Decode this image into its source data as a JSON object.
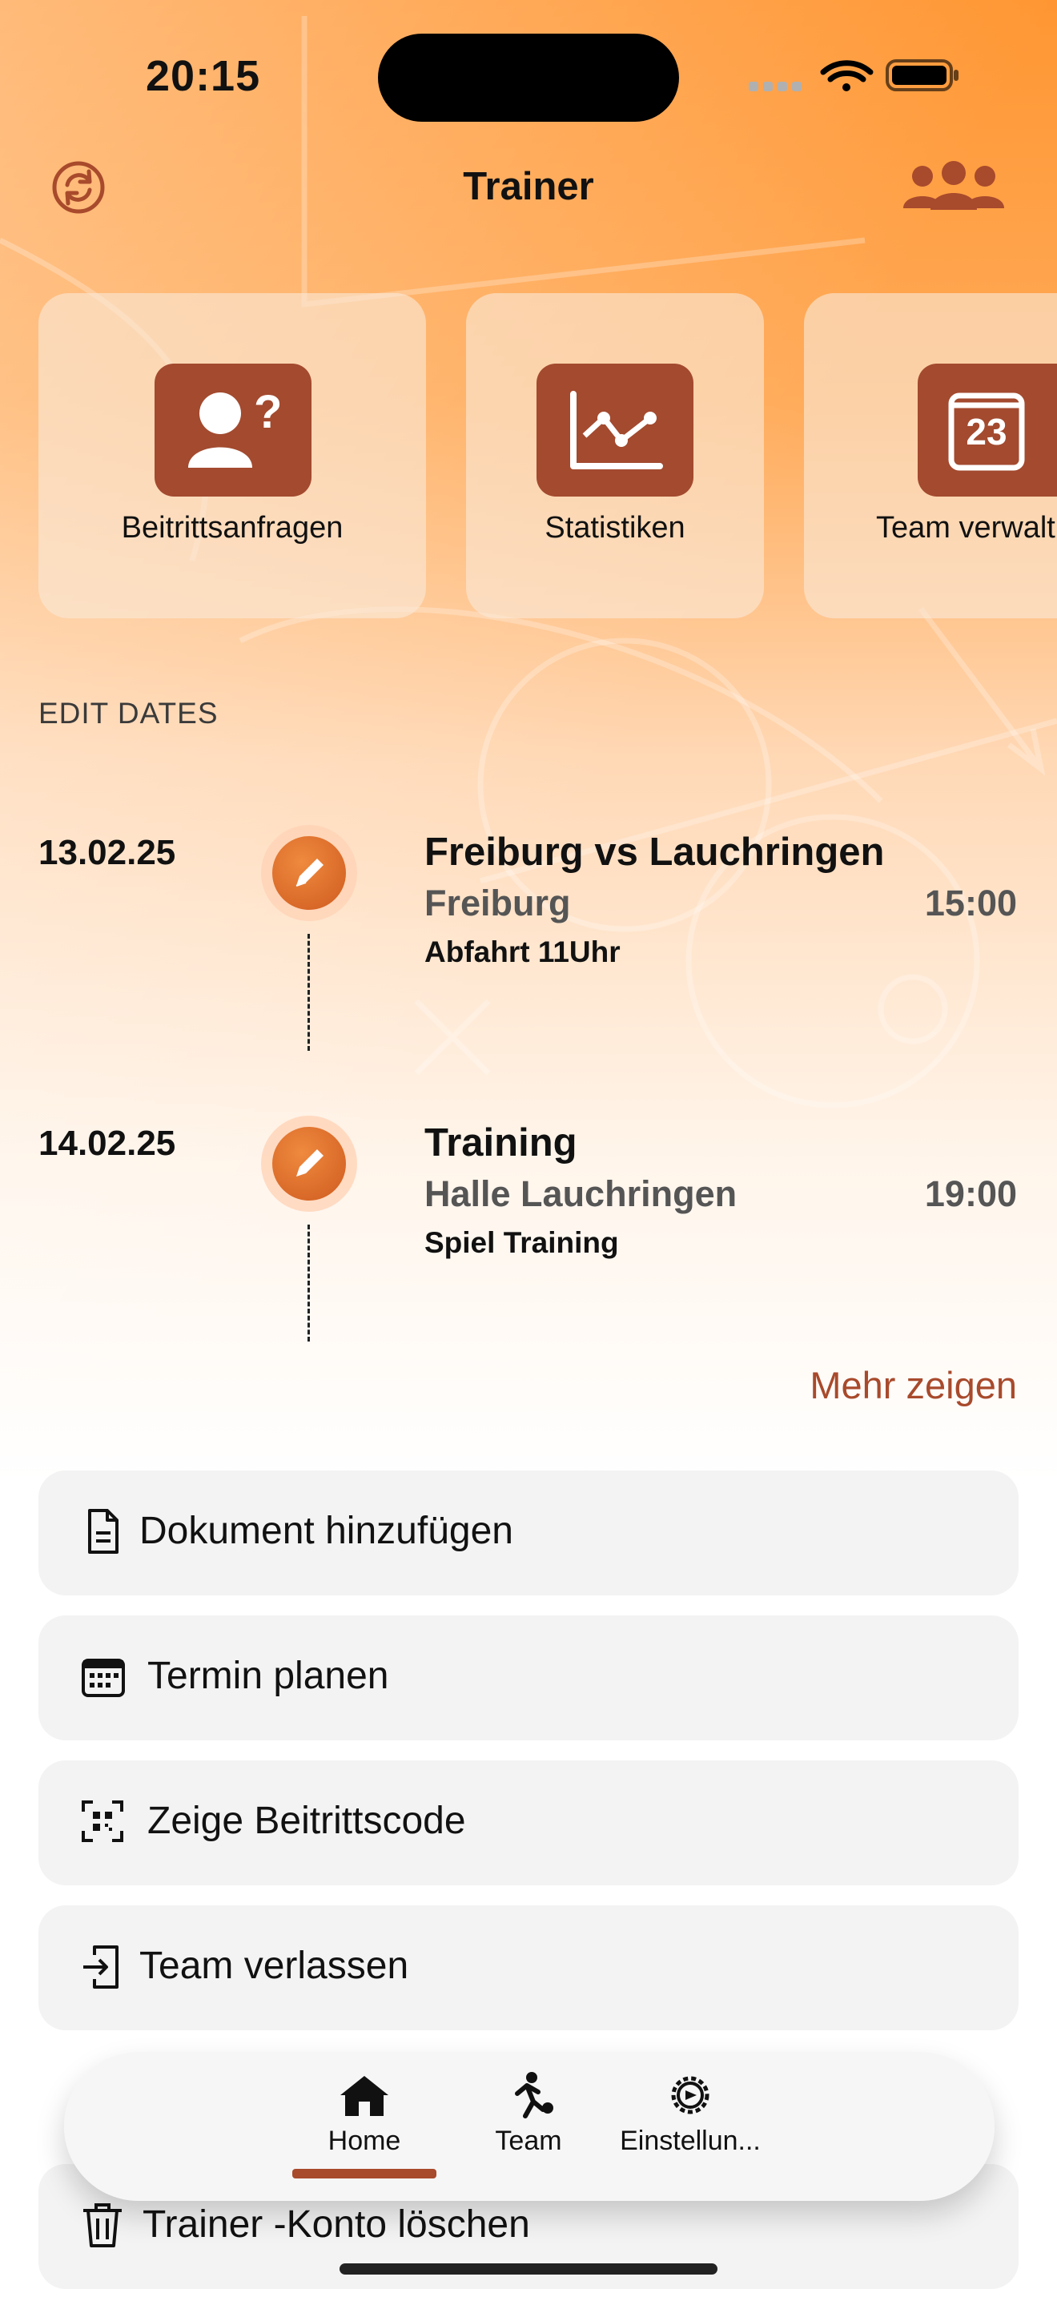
{
  "status_bar": {
    "time": "20:15"
  },
  "nav": {
    "title": "Trainer",
    "left_icon": "refresh-icon",
    "right_icon": "group-icon"
  },
  "quick_actions": [
    {
      "label": "Beitrittsanfragen",
      "icon": "person-question-icon"
    },
    {
      "label": "Statistiken",
      "icon": "line-chart-icon"
    },
    {
      "label": "Team verwalt",
      "icon": "calendar-23-icon",
      "calendar_day": "23"
    }
  ],
  "section_header": "EDIT DATES",
  "events": [
    {
      "date": "13.02.25",
      "title": "Freiburg vs Lauchringen",
      "location": "Freiburg",
      "time": "15:00",
      "note": "Abfahrt 11Uhr"
    },
    {
      "date": "14.02.25",
      "title": "Training",
      "location": "Halle Lauchringen",
      "time": "19:00",
      "note": "Spiel Training"
    }
  ],
  "more_link": "Mehr zeigen",
  "actions": [
    {
      "label": "Dokument hinzufügen",
      "icon": "document-icon"
    },
    {
      "label": "Termin planen",
      "icon": "calendar-icon"
    },
    {
      "label": "Zeige Beitrittscode",
      "icon": "qr-code-icon"
    },
    {
      "label": "Team verlassen",
      "icon": "leave-icon"
    },
    {
      "label": "Trainer -Konto löschen",
      "icon": "trash-icon"
    }
  ],
  "tabs": [
    {
      "label": "Home",
      "icon": "house-icon",
      "selected": true
    },
    {
      "label": "Team",
      "icon": "runner-icon",
      "selected": false
    },
    {
      "label": "Einstellun...",
      "icon": "gear-icon",
      "selected": false
    }
  ],
  "colors": {
    "accent": "#a84a2c",
    "icon_tile": "#a34a2f",
    "gradient_top": "#ff9632"
  }
}
